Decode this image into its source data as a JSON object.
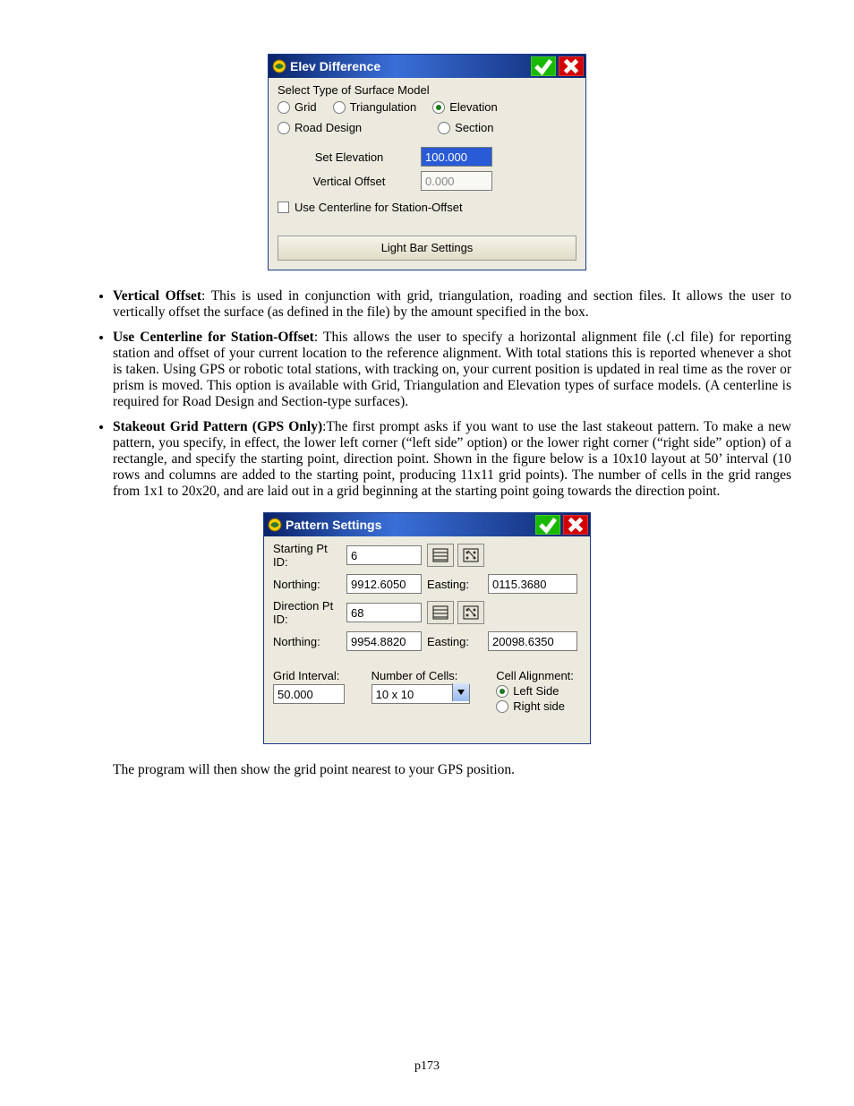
{
  "page_number": "p173",
  "elev_dialog": {
    "title": "Elev Difference",
    "section_label": "Select Type of Surface Model",
    "radios": {
      "grid": "Grid",
      "triangulation": "Triangulation",
      "elevation": "Elevation",
      "road_design": "Road Design",
      "section": "Section",
      "selected": "elevation"
    },
    "set_elevation_label": "Set Elevation",
    "set_elevation_value": "100.000",
    "vertical_offset_label": "Vertical Offset",
    "vertical_offset_value": "0.000",
    "centerline_checkbox_label": "Use Centerline for Station-Offset",
    "light_bar_button": "Light Bar Settings"
  },
  "bullets": [
    {
      "term": "Vertical Offset",
      "text": ": This is used in conjunction with grid, triangulation, roading and section files.  It allows the user to vertically offset the surface (as defined in the file) by the amount specified in the box."
    },
    {
      "term": "Use Centerline for Station-Offset",
      "text": ":  This allows the user to specify a horizontal alignment file (.cl file) for reporting station and offset of your current location to the reference alignment.  With total stations this is reported whenever a shot is taken. Using GPS or robotic total stations, with tracking on, your current position is updated in real time as the rover or prism is moved.  This option is available with Grid, Triangulation and Elevation types of surface models.  (A centerline is required for Road Design and Section-type surfaces)."
    },
    {
      "term": "Stakeout Grid Pattern (GPS Only)",
      "text": ":The first prompt asks if you want to use the last stakeout pattern.  To make a new pattern, you specify, in effect, the lower left corner (“left side” option) or the lower right corner (“right side” option) of a rectangle, and specify the starting point, direction point.  Shown in the figure below is a 10x10 layout at 50’ interval (10 rows and columns are added to the starting point, producing 11x11 grid points).  The number of cells in the grid ranges from 1x1 to 20x20, and are laid out in a grid beginning at the starting point going towards the direction point."
    }
  ],
  "pattern_dialog": {
    "title": "Pattern Settings",
    "starting_pt_id_label": "Starting Pt ID:",
    "starting_pt_id_value": "6",
    "northing_label": "Northing:",
    "easting_label": "Easting:",
    "start_northing": "9912.6050",
    "start_easting": "0115.3680",
    "direction_pt_id_label": "Direction Pt ID:",
    "direction_pt_id_value": "68",
    "dir_northing": "9954.8820",
    "dir_easting": "20098.6350",
    "grid_interval_label": "Grid Interval:",
    "grid_interval_value": "50.000",
    "num_cells_label": "Number of Cells:",
    "num_cells_value": "10 x 10",
    "cell_alignment_label": "Cell Alignment:",
    "align_left": "Left Side",
    "align_right": "Right side",
    "align_selected": "left"
  },
  "trailing_paragraph": "The program will then show the grid point nearest to your GPS position."
}
